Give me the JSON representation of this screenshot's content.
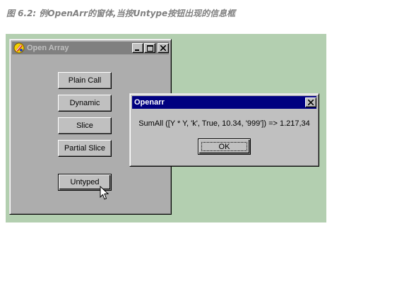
{
  "caption": "图 6.2: 例OpenArr的窗体,当按Untype按钮出现的信息框",
  "main_window": {
    "title": "Open Array",
    "buttons": [
      {
        "label": "Plain Call"
      },
      {
        "label": "Dynamic"
      },
      {
        "label": "Slice"
      },
      {
        "label": "Partial Slice"
      },
      {
        "label": "Untyped"
      }
    ]
  },
  "dialog": {
    "title": "Openarr",
    "message": "SumAll ([Y * Y, 'k', True, 10.34, '999']) => 1.217,34",
    "ok_label": "OK"
  },
  "colors": {
    "stage_background": "#b3cfb0",
    "inactive_titlebar": "#808080",
    "active_titlebar": "#000080",
    "window_face": "#c0c0c0"
  },
  "icons": {
    "app": "delphi-app-icon",
    "minimize": "minimize-icon",
    "maximize": "maximize-icon",
    "close": "close-icon",
    "cursor": "mouse-pointer-icon"
  }
}
